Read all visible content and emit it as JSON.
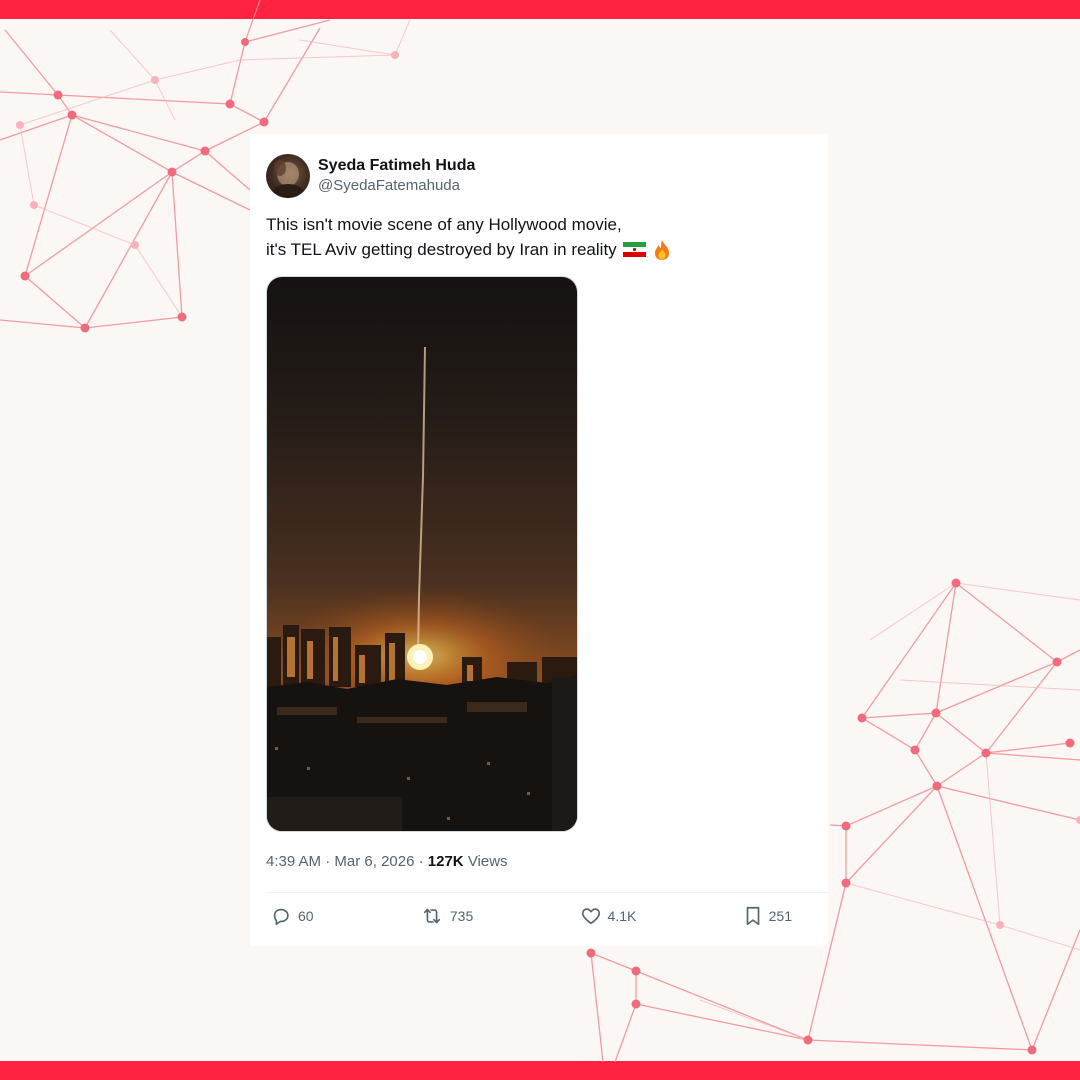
{
  "colors": {
    "frame": "#ff2341",
    "network_line": "#f58a95",
    "network_node": "#f06b7b",
    "text_primary": "#0f1419",
    "text_secondary": "#536471"
  },
  "tweet": {
    "author": {
      "display_name": "Syeda Fatimeh Huda",
      "handle": "@SyedaFatemahuda"
    },
    "text_line1": "This isn't movie scene of any Hollywood movie,",
    "text_line2": "it's TEL Aviv getting destroyed by Iran in reality",
    "emojis": [
      "iran-flag-icon",
      "fire-icon"
    ],
    "time": "4:39 AM",
    "separator1": "·",
    "date": "Mar 6, 2026",
    "separator2": "·",
    "views_count": "127K",
    "views_label": "Views",
    "actions": {
      "replies": "60",
      "reposts": "735",
      "likes": "4.1K",
      "bookmarks": "251"
    }
  }
}
